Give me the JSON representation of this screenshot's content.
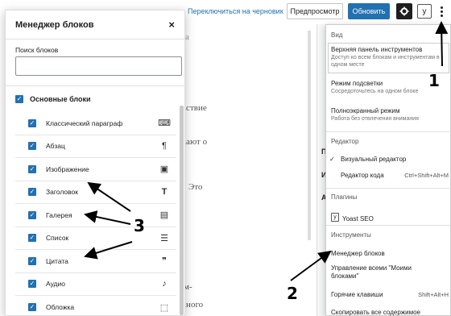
{
  "topbar": {
    "switch_draft": "Переключиться на черновик",
    "preview": "Предпросмотр",
    "update": "Обновить",
    "yoast_icon": "y-icon"
  },
  "background": {
    "texts": [
      "іствие",
      "іают о",
      "Это",
      "м-",
      "іного",
      "а",
      "в"
    ],
    "side_letters": [
      "П",
      "И",
      "А"
    ]
  },
  "modal": {
    "title": "Менеджер блоков",
    "close": "×",
    "search_label": "Поиск блоков",
    "search_value": "",
    "category": "Основные блоки",
    "blocks": [
      {
        "label": "Классический параграф",
        "icon": "classic-icon",
        "glyph": "⌨"
      },
      {
        "label": "Абзац",
        "icon": "paragraph-icon",
        "glyph": "¶"
      },
      {
        "label": "Изображение",
        "icon": "image-icon",
        "glyph": "▣"
      },
      {
        "label": "Заголовок",
        "icon": "heading-icon",
        "glyph": "T"
      },
      {
        "label": "Галерея",
        "icon": "gallery-icon",
        "glyph": "▤"
      },
      {
        "label": "Список",
        "icon": "list-icon",
        "glyph": "☰"
      },
      {
        "label": "Цитата",
        "icon": "quote-icon",
        "glyph": "❞"
      },
      {
        "label": "Аудио",
        "icon": "audio-icon",
        "glyph": "♪"
      },
      {
        "label": "Обложка",
        "icon": "cover-icon",
        "glyph": "⬚"
      }
    ]
  },
  "menu": {
    "view_title": "Вид",
    "top_toolbar": {
      "label": "Верхняя панель инструментов",
      "desc": "Доступ ко всем блокам и инструментам в одном месте"
    },
    "spotlight": {
      "label": "Режим подсветки",
      "desc": "Сосредоточьтесь на одном блоке"
    },
    "fullscreen": {
      "label": "Полноэкранный режим",
      "desc": "Работа без отвлечения внимания"
    },
    "editor_title": "Редактор",
    "visual_editor": "Визуальный редактор",
    "code_editor": "Редактор кода",
    "code_shortcut": "Ctrl+Shift+Alt+M",
    "plugins_title": "Плагины",
    "yoast": "Yoast SEO",
    "tools_title": "Инструменты",
    "block_manager": "Менеджер блоков",
    "manage_reusable": "Управление всеми \"Моими блоками\"",
    "shortcuts": "Горячие клавиши",
    "shortcuts_key": "Shift+Alt+H",
    "copy_all": "Скопировать все содержимое"
  },
  "annotations": {
    "one": "1",
    "two": "2",
    "three": "3"
  }
}
